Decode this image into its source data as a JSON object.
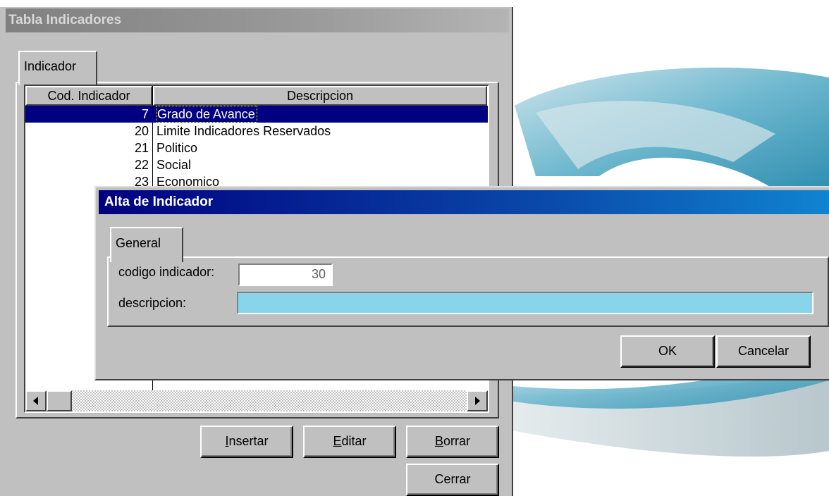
{
  "back_window": {
    "title": "Tabla Indicadores",
    "tab_label": "Indicador",
    "table": {
      "columns": [
        "Cod. Indicador",
        "Descripcion"
      ],
      "rows": [
        {
          "code": "7",
          "desc": "Grado de Avance"
        },
        {
          "code": "20",
          "desc": "Limite Indicadores Reservados"
        },
        {
          "code": "21",
          "desc": "Politico"
        },
        {
          "code": "22",
          "desc": "Social"
        },
        {
          "code": "23",
          "desc": "Economico"
        }
      ]
    },
    "buttons": {
      "insertar": {
        "mnemonic": "I",
        "rest": "nsertar"
      },
      "editar": {
        "mnemonic": "E",
        "rest": "ditar"
      },
      "borrar": {
        "mnemonic": "B",
        "rest": "orrar"
      },
      "cerrar": "Cerrar"
    }
  },
  "dialog": {
    "title": "Alta de Indicador",
    "tab_label": "General",
    "fields": {
      "code_label": "codigo indicador:",
      "code_value": "30",
      "desc_label": "descripcion:",
      "desc_value": ""
    },
    "buttons": {
      "ok": "OK",
      "cancel": "Cancelar"
    }
  },
  "colors": {
    "selection": "#000080",
    "active_title": "#000080",
    "description_field": "#87d4eb",
    "window_face": "#c0c0c0"
  }
}
